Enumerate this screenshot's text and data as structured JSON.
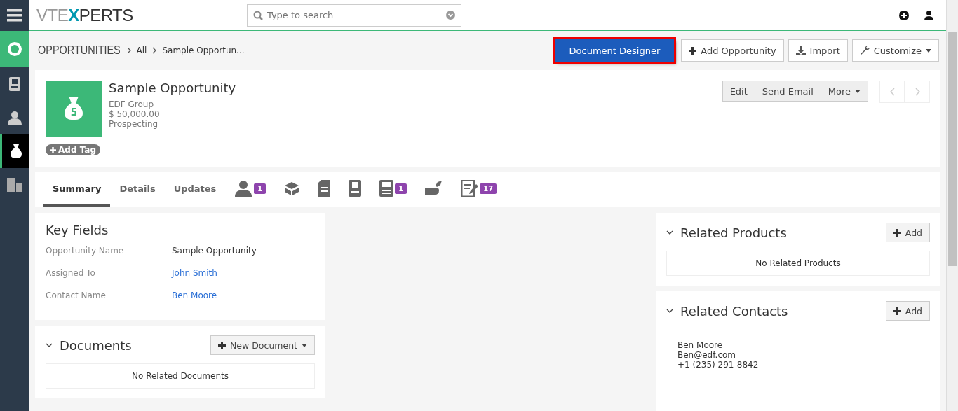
{
  "sidebar": {
    "items": [
      {
        "kind": "menu",
        "selected": false
      },
      {
        "kind": "app",
        "selected": false
      },
      {
        "kind": "module",
        "selected": false
      },
      {
        "kind": "module",
        "selected": false
      },
      {
        "kind": "module",
        "selected": true
      },
      {
        "kind": "module",
        "selected": false
      }
    ]
  },
  "header": {
    "logo": {
      "left": "VTE",
      "mark": "X",
      "right": "PERTS"
    },
    "search": {
      "placeholder": "Type to search"
    }
  },
  "breadcrumb": {
    "module": "OPPORTUNITIES",
    "items": [
      "All",
      "Sample Opportun..."
    ]
  },
  "actions": [
    {
      "label": "Document Designer",
      "kind": "primary",
      "highlighted": true
    },
    {
      "label": "Add Opportunity",
      "kind": "plus",
      "highlighted": false
    },
    {
      "label": "Import",
      "kind": "import",
      "highlighted": false
    },
    {
      "label": "Customize",
      "kind": "wrench",
      "highlighted": false
    }
  ],
  "record": {
    "title": "Sample Opportunity",
    "lines": [
      "EDF Group",
      "$ 50,000.00",
      "Prospecting"
    ],
    "tag_button": "Add Tag",
    "buttons": [
      "Edit",
      "Send Email",
      "More"
    ]
  },
  "tabs": [
    {
      "kind": "text",
      "label": "Summary",
      "selected": true
    },
    {
      "kind": "text",
      "label": "Details",
      "selected": false
    },
    {
      "kind": "text",
      "label": "Updates",
      "selected": false
    },
    {
      "kind": "icon",
      "badge": "1",
      "selected": false
    },
    {
      "kind": "icon",
      "selected": false
    },
    {
      "kind": "icon",
      "selected": false
    },
    {
      "kind": "icon",
      "selected": false
    },
    {
      "kind": "icon",
      "badge": "1",
      "selected": false
    },
    {
      "kind": "icon",
      "selected": false
    },
    {
      "kind": "icon",
      "badge": "17",
      "selected": false
    }
  ],
  "key_fields": {
    "title": "Key Fields",
    "rows": [
      {
        "label": "Opportunity Name",
        "value": "Sample Opportunity",
        "kind": "text"
      },
      {
        "label": "Assigned To",
        "value": "John Smith",
        "kind": "link"
      },
      {
        "label": "Contact Name",
        "value": "Ben Moore",
        "kind": "link"
      }
    ]
  },
  "documents": {
    "title": "Documents",
    "button": "New Document",
    "empty": "No Related Documents"
  },
  "related_products": {
    "title": "Related Products",
    "button": "Add",
    "empty": "No Related Products"
  },
  "related_contacts": {
    "title": "Related Contacts",
    "button": "Add",
    "contact": [
      "Ben Moore",
      "Ben@edf.com",
      "+1 (235) 291-8842"
    ]
  }
}
